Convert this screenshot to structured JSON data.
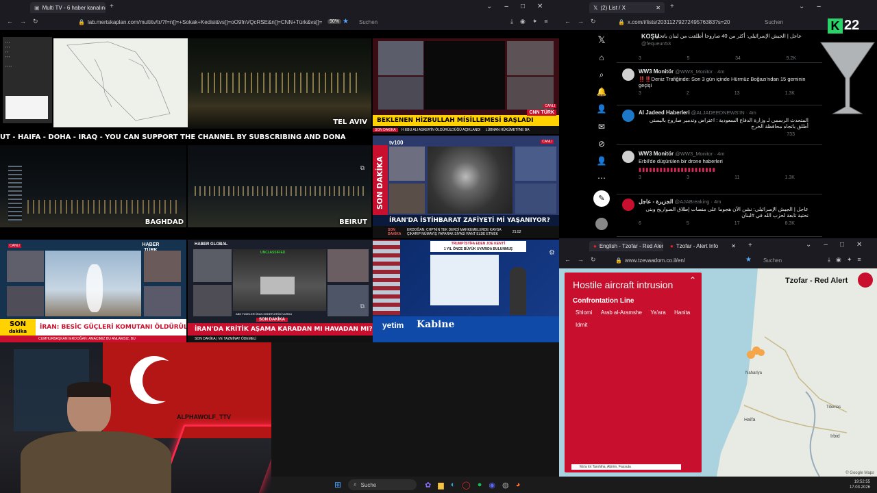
{
  "left_browser": {
    "tab_title": "Multi TV - 6 haber kanalını aynı",
    "url": "lab.mertskaplan.com/multitv/tr/?f=n[]=+Sokak+Kedisi&vs[]=oO9fnVQcRSE&n[]=CNN+Türk&vs[]=",
    "zoom": "90%",
    "search_placeholder": "Suchen"
  },
  "twitter_browser": {
    "tab_title": "(2) List / X",
    "url": "x.com/i/lists/2031127927249576383?s=20",
    "search_placeholder": "Suchen"
  },
  "alert_browser": {
    "tab1_title": "English - Tzofar - Red Alert",
    "tab2_title": "Tzofar - Alert Info",
    "url": "www.tzevaadom.co.il/en/",
    "search_placeholder": "Suchen"
  },
  "k22_logo": "22",
  "tiles": {
    "tel_aviv": "TEL AVIV",
    "baghdad": "BAGHDAD",
    "beirut": "BEIRUT",
    "scroll_ticker": "UT - HAIFA - DOHA - IRAQ - YOU CAN SUPPORT THE CHANNEL BY SUBSCRIBING AND DONA",
    "cnn_headline": "BEKLENEN HİZBULLAH MİSİLLEMESİ BAŞLADI",
    "cnn_brand": "CNN TÜRK",
    "cnn_label": "CANLI",
    "cnn_subline_1": "SON DAKİKA",
    "cnn_subline_2": "H EBU ALI ASKER'İN ÖLDÜRÜLDÜĞÜ AÇIKLANDI",
    "cnn_subline_3": "LÜBNAN HÜKÜMETİ'NE BA",
    "tv100_vertical": "SON DAKİKA",
    "tv100_headline": "İRAN'DA İSTİHBARAT ZAFİYETİ Mİ YAŞANIYOR?",
    "tv100_sub_label": "SON DAKİKA",
    "tv100_sub": "ERDOĞAN: CHP'NİN TEK DERDİ MAHKEMELERDE KAVGA ÇIKARIP NÜMAYİŞ YAPARAK SİYASİ RANT ELDE ETMEK",
    "tv100_time": "21:52",
    "tv100_brand": "tv100",
    "tv100_live": "CANLI",
    "haberturk_brand": "HABER TÜRK",
    "haberturk_son": "SON",
    "haberturk_dakika": "dakika",
    "haberturk_headline": "İRAN: BESİC GÜÇLERİ KOMUTANI ÖLDÜRÜLDÜ",
    "haberturk_sub": "CUMHURBAŞKANI ERDOĞAN: AMACIMIZ BU ANLAMSIZ, BU",
    "haberturk_live": "CANLI",
    "haberglobal_brand": "HABER GLOBAL",
    "haberglobal_son": "SON DAKİKA",
    "haberglobal_headline": "İRAN'DA KRİTİK AŞAMA KARADAN MI HAVADAN MI?",
    "haberglobal_sub": "SON DAKİKA | VE TAZMİNAT ÖDEMELİ",
    "haberglobal_caption": "ABD FÜZELERİ İRAN HEDEFLERİNİ VURDU",
    "haberglobal_unclassified": "UNCLASSIFIED",
    "ad_trump": "TRUMP İSTİFA EDEN JOE KENT'İ",
    "ad_trump_sub": "1 YIL ÖNCE BÜYÜK UYARIDA BULUNMUŞ",
    "ad_yetim": "yetim",
    "ad_kabine": "Kabine",
    "stream_name": "ALPHAWOLF_TTV"
  },
  "tweets": [
    {
      "name": "",
      "handle": "@fequeun53",
      "text": "KOŞU",
      "replies": "3",
      "retweets": "5",
      "likes": "34",
      "views": "9.2K"
    },
    {
      "name": "WW3 Monitör",
      "handle": "@WW3_Monitor · 4m",
      "text": "‼️‼️Deniz Trafiğinde: Son 3 gün içinde Hürmüz Boğazı'ndan 15 geminin geçişi",
      "replies": "3",
      "retweets": "2",
      "likes": "13",
      "views": "1.3K"
    },
    {
      "name": "Al Jadeed Haberleri",
      "handle": "@ALJADEEDNEWS'IN · 4m",
      "text": "المتحدث الرسمي لـ وزارة الدفاع السعودية : اعتراض وتدمير صاروخ باليستي أطلق باتجاه محافظة الخرج",
      "replies": "",
      "retweets": "",
      "likes": "",
      "views": "733"
    },
    {
      "name": "WW3 Monitör",
      "handle": "@WW3_Monitor · 4m",
      "text": "Erbil'de düşürülen bir drone haberleri",
      "replies": "3",
      "retweets": "3",
      "likes": "11",
      "views": "1.3K"
    },
    {
      "name": "الجزيرة - عاجل",
      "handle": "@AJABreaking · 4m",
      "text": "عاجل | الجيش الإسرائيلي: نشن الآن هجوما على منصات إطلاق الصواريخ وبنى تحتية تابعة لحزب الله في #لبنان",
      "replies": "6",
      "retweets": "5",
      "likes": "17",
      "views": "8.3K"
    }
  ],
  "top_tweet_arabic": "عاجل | الجيش الإسرائيلي: أكثر من 40 صاروخا أطلقت من لبنان باتجاه",
  "alert": {
    "title": "Hostile aircraft intrusion",
    "region": "Confrontation Line",
    "places": [
      "Shlomi",
      "Arab al-Aramshe",
      "Ya'ara",
      "Hanita",
      "Idmit"
    ],
    "footer": "Ma'a lot Tarshiha, Abirim, Fassuta",
    "map_title": "Tzofar - Red Alert",
    "map_labels": {
      "nahariya": "Nahariya",
      "haifa": "Haifa",
      "irbid": "Irbid",
      "tiberias": "Tiberias"
    },
    "copyright": "© Google Maps"
  },
  "taskbar": {
    "search_placeholder": "Suche",
    "time": "19:52:55",
    "date": "17.03.2026"
  },
  "colors": {
    "alert_red": "#c8102e",
    "tweet_bg": "#000000",
    "map_land": "#e7ebe3",
    "map_sea": "#aad3df"
  }
}
